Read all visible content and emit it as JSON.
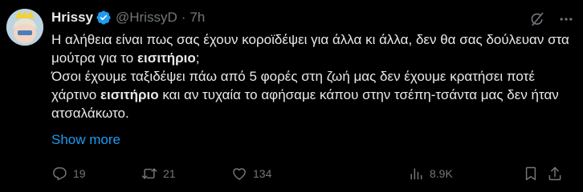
{
  "author": {
    "name": "Hrissy",
    "handle": "@HrissyD",
    "separator": "·",
    "time": "7h",
    "verified": true
  },
  "tweet": {
    "p1": [
      {
        "text": "Η αλήθεια είναι πως σας έχουν κοροϊδέψει για άλλα κι άλλα, δεν θα σας δούλευαν στα μούτρα για το ",
        "bold": false
      },
      {
        "text": "εισιτήριο",
        "bold": true
      },
      {
        "text": ";",
        "bold": false
      }
    ],
    "p2": [
      {
        "text": "Όσοι έχουμε ταξιδέψει πάω από 5 φορές στη ζωή μας δεν έχουμε κρατήσει ποτέ χάρτινο ",
        "bold": false
      },
      {
        "text": "εισιτήριο",
        "bold": true
      },
      {
        "text": " και αν τυχαία το αφήσαμε κάπου στην τσέπη-τσάντα μας δεν ήταν ατσαλάκωτο.",
        "bold": false
      }
    ],
    "show_more": "Show more"
  },
  "stats": {
    "replies": "19",
    "retweets": "21",
    "likes": "134",
    "views": "8.9K"
  },
  "icons": {
    "verified": "verified-badge-icon",
    "grok": "grok-icon",
    "more": "more-horizontal-icon",
    "reply": "reply-icon",
    "retweet": "retweet-icon",
    "like": "heart-icon",
    "views": "views-chart-icon",
    "bookmark": "bookmark-icon",
    "share": "share-icon"
  },
  "colors": {
    "background": "#000000",
    "text": "#e7e9ea",
    "muted": "#71767b",
    "accent": "#1d9bf0"
  }
}
